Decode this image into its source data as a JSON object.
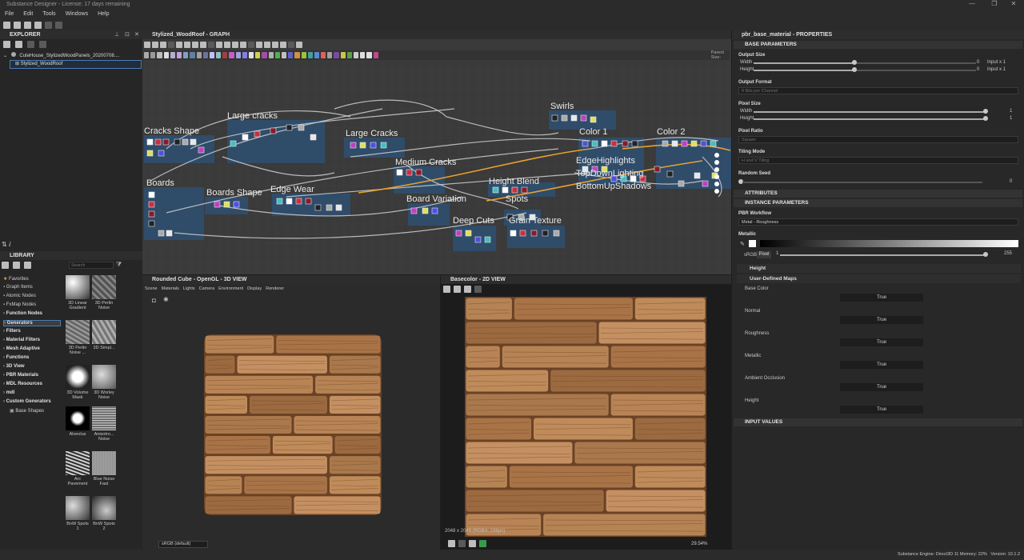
{
  "window": {
    "title": "Substance Designer - License: 17 days remaining",
    "controls": [
      "—",
      "❐",
      "✕"
    ]
  },
  "menu": [
    "File",
    "Edit",
    "Tools",
    "Windows",
    "Help"
  ],
  "explorer": {
    "title": "EXPLORER",
    "package": "CuteHouse_StylizedWoodPanels_20200708....",
    "graph": "Stylized_WoodRoof"
  },
  "library": {
    "title": "LIBRARY",
    "search_placeholder": "Search",
    "tree": [
      {
        "label": "Favorites",
        "icon": "star-icon"
      },
      {
        "label": "Graph Items"
      },
      {
        "label": "Atomic Nodes"
      },
      {
        "label": "FxMap Nodes"
      },
      {
        "label": "Function Nodes",
        "bold": true
      },
      {
        "label": "Generators",
        "bold": true,
        "selected": true
      },
      {
        "label": "Filters",
        "bold": true
      },
      {
        "label": "Material Filters",
        "bold": true
      },
      {
        "label": "Mesh Adaptive",
        "bold": true
      },
      {
        "label": "Functions",
        "bold": true
      },
      {
        "label": "3D View",
        "bold": true
      },
      {
        "label": "PBR Materials",
        "bold": true
      },
      {
        "label": "MDL Resources",
        "bold": true
      },
      {
        "label": "mdl",
        "bold": true
      },
      {
        "label": "Custom Generators",
        "bold": true
      },
      {
        "label": "Base Shapes"
      }
    ],
    "items": [
      {
        "label": "3D Linear Gradient"
      },
      {
        "label": "3D Perlin Noise"
      },
      {
        "label": "3D Perlin Noise ..."
      },
      {
        "label": "3D Simpl..."
      },
      {
        "label": "3D Volume Mask"
      },
      {
        "label": "3D Worley Noise"
      },
      {
        "label": "Alveolus"
      },
      {
        "label": "Anisotro... Noise"
      },
      {
        "label": "Arc Pavement"
      },
      {
        "label": "Blue Noise Fast"
      },
      {
        "label": "BnW Spots 1"
      },
      {
        "label": "BnW Spots 2"
      }
    ]
  },
  "graph": {
    "title": "Stylized_WoodRoof - GRAPH",
    "parent_size_label": "Parent Size:",
    "frames": [
      {
        "label": "Cracks Shape"
      },
      {
        "label": "Large cracks"
      },
      {
        "label": "Large Cracks"
      },
      {
        "label": "Medium Cracks"
      },
      {
        "label": "Swirls"
      },
      {
        "label": "Color 1"
      },
      {
        "label": "Color 2"
      },
      {
        "label": "Boards"
      },
      {
        "label": "Boards Shape"
      },
      {
        "label": "Edge Wear"
      },
      {
        "label": "Board Variation"
      },
      {
        "label": "Height Blend"
      },
      {
        "label": "Spots"
      },
      {
        "label": "Deep Cuts"
      },
      {
        "label": "Grain Texture"
      },
      {
        "label": "EdgeHighlights"
      },
      {
        "label": "TopDownLighting"
      },
      {
        "label": "BottomUpShadows"
      }
    ]
  },
  "view3d": {
    "title": "Rounded Cube - OpenGL - 3D VIEW",
    "menu": [
      "Scene",
      "Materials",
      "Lights",
      "Camera",
      "Environment",
      "Display",
      "Renderer"
    ],
    "colorspace": "sRGB (default)"
  },
  "view2d": {
    "title": "Basecolor - 2D VIEW",
    "resolution": "2048 x 2048 (RGBA, 16bpc)",
    "zoom": "29.54%"
  },
  "properties": {
    "title": "pbr_base_material - PROPERTIES",
    "base_parameters": "BASE PARAMETERS",
    "output_size": {
      "label": "Output Size",
      "width_label": "Width",
      "height_label": "Height",
      "width_value": "0",
      "height_value": "0",
      "width_suffix": "Input x 1",
      "height_suffix": "Input x 1"
    },
    "output_format": {
      "label": "Output Format",
      "value": "8 Bits per Channel"
    },
    "pixel_size": {
      "label": "Pixel Size",
      "width_label": "Width",
      "height_label": "Height",
      "width_value": "1",
      "height_value": "1"
    },
    "pixel_ratio": {
      "label": "Pixel Ratio",
      "value": "Square"
    },
    "tiling_mode": {
      "label": "Tiling Mode",
      "value": "H and V Tiling"
    },
    "random_seed": {
      "label": "Random Seed",
      "value": "0"
    },
    "attributes": "ATTRIBUTES",
    "instance_parameters": "INSTANCE PARAMETERS",
    "pbr_workflow": {
      "label": "PBR Workflow",
      "value": "Metal - Roughness"
    },
    "metallic": {
      "label": "Metallic",
      "srgb": "sRGB",
      "pixel": "Pixel",
      "min": "1",
      "max": "255"
    },
    "height_group": "Height",
    "user_defined_maps": "User-Defined Maps",
    "maps": [
      {
        "label": "Base Color",
        "value": "True"
      },
      {
        "label": "Normal",
        "value": "True"
      },
      {
        "label": "Roughness",
        "value": "True"
      },
      {
        "label": "Metallic",
        "value": "True"
      },
      {
        "label": "Ambient Occlusion",
        "value": "True"
      },
      {
        "label": "Height",
        "value": "True"
      }
    ],
    "input_values": "INPUT VALUES"
  },
  "status": {
    "engine": "Substance Engine: Direct3D 11",
    "memory": "Memory: 22%",
    "version": "Version: 10.1.2"
  },
  "colors": {
    "frame_blue": "#2f4f6f",
    "wood_light": "#b07c4e",
    "wood_dark": "#7a4c2a",
    "accent_orange": "#e8a030"
  }
}
